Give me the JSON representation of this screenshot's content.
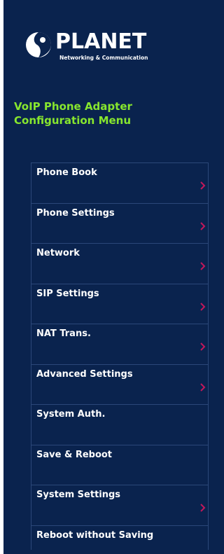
{
  "brand": {
    "name": "PLANET",
    "tagline": "Networking & Communication"
  },
  "title": {
    "line1": "VoIP Phone Adapter",
    "line2": "Configuration Menu"
  },
  "menu": {
    "items": [
      {
        "label": "Phone Book",
        "has_submenu": true
      },
      {
        "label": "Phone Settings",
        "has_submenu": true
      },
      {
        "label": "Network",
        "has_submenu": true
      },
      {
        "label": "SIP Settings",
        "has_submenu": true
      },
      {
        "label": "NAT Trans.",
        "has_submenu": true
      },
      {
        "label": "Advanced Settings",
        "has_submenu": true
      },
      {
        "label": "System Auth.",
        "has_submenu": false
      },
      {
        "label": "Save & Reboot",
        "has_submenu": false
      },
      {
        "label": "System Settings",
        "has_submenu": true
      },
      {
        "label": "Reboot without Saving",
        "has_submenu": false
      }
    ]
  },
  "colors": {
    "background": "#0a234e",
    "title": "#87e62e",
    "chevron": "#c2185b",
    "menu_text": "#ffffff",
    "divider": "#2b4779"
  },
  "icons": {
    "chevron": "chevron-right-icon",
    "logo": "planet-logo-icon"
  }
}
